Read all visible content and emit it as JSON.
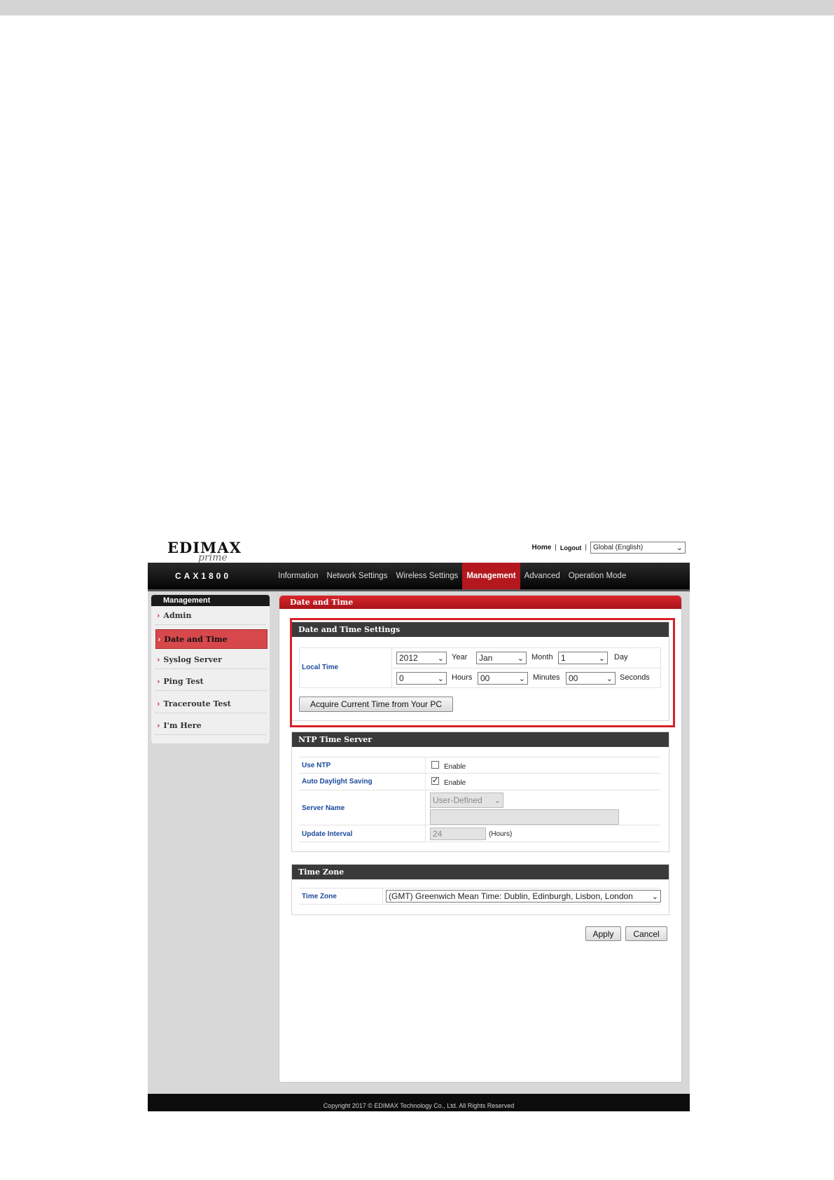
{
  "header": {
    "brand": "EDIMAX",
    "brand_sub": "prime",
    "links": {
      "home": "Home",
      "logout": "Logout",
      "separator": "|"
    },
    "language_select": "Global (English)"
  },
  "navbar": {
    "model": "CAX1800",
    "items": [
      "Information",
      "Network Settings",
      "Wireless Settings",
      "Management",
      "Advanced",
      "Operation Mode"
    ],
    "active": "Management"
  },
  "sidebar": {
    "title": "Management",
    "items": [
      {
        "label": "Admin"
      },
      {
        "label": "Date and Time"
      },
      {
        "label": "Syslog Server"
      },
      {
        "label": "Ping Test"
      },
      {
        "label": "Traceroute Test"
      },
      {
        "label": "I'm Here"
      }
    ],
    "active": "Date and Time"
  },
  "main": {
    "title": "Date and Time",
    "date_time": {
      "heading": "Date and Time Settings",
      "local_time_label": "Local Time",
      "year": {
        "value": "2012",
        "unit": "Year"
      },
      "month": {
        "value": "Jan",
        "unit": "Month"
      },
      "day": {
        "value": "1",
        "unit": "Day"
      },
      "hours": {
        "value": "0",
        "unit": "Hours"
      },
      "minutes": {
        "value": "00",
        "unit": "Minutes"
      },
      "seconds": {
        "value": "00",
        "unit": "Seconds"
      },
      "acquire_button": "Acquire Current Time from Your PC"
    },
    "ntp": {
      "heading": "NTP Time Server",
      "use_ntp_label": "Use NTP",
      "use_ntp_checkbox": "Enable",
      "use_ntp_checked": false,
      "auto_dst_label": "Auto Daylight Saving",
      "auto_dst_checkbox": "Enable",
      "auto_dst_checked": true,
      "check_mark": "✓",
      "server_name_label": "Server Name",
      "server_select": "User-Defined",
      "server_input": "",
      "update_interval_label": "Update Interval",
      "update_interval_value": "24",
      "update_interval_unit": "(Hours)"
    },
    "timezone": {
      "heading": "Time Zone",
      "label": "Time Zone",
      "value": "(GMT) Greenwich Mean Time: Dublin, Edinburgh, Lisbon, London"
    },
    "buttons": {
      "apply": "Apply",
      "cancel": "Cancel"
    }
  },
  "footer": {
    "copyright": "Copyright 2017 © EDIMAX Technology Co., Ltd. All Rights Reserved"
  }
}
